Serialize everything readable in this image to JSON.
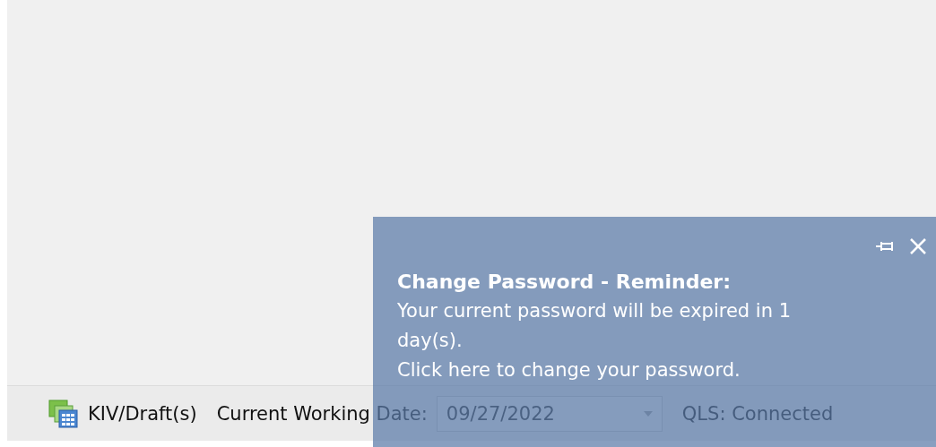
{
  "status_bar": {
    "kiv_label": "KIV/Draft(s)",
    "date_label": "Current Working Date:",
    "date_value": "09/27/2022",
    "connection": "QLS: Connected"
  },
  "notification": {
    "title": "Change Password - Reminder:",
    "message": "Your current password will be expired in 1 day(s).",
    "link": "Click here to change your password."
  }
}
